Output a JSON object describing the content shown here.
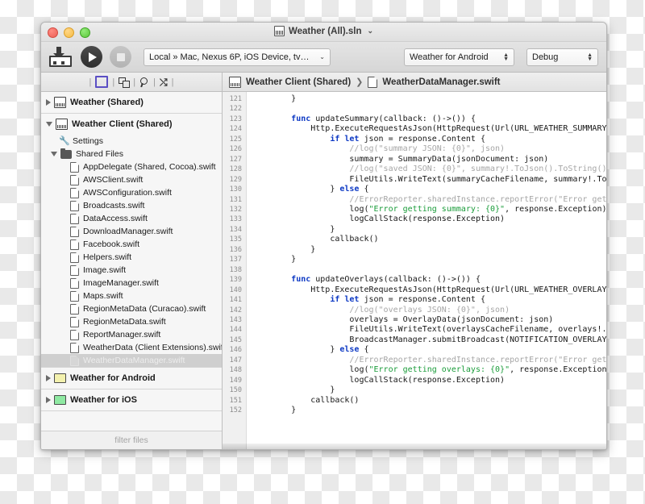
{
  "window": {
    "title": "Weather (All).sln",
    "title_chevron": "⌄",
    "app_icon": "save-to-tray-icon"
  },
  "toolbar": {
    "run_label": "Run",
    "stop_label": "Stop",
    "target": {
      "value": "Local » Mac, Nexus 6P, iOS Device, tv…",
      "chevron": "⌄"
    },
    "project": {
      "value": "Weather for Android",
      "stepper_up": "▲",
      "stepper_down": "▼"
    },
    "configuration": {
      "value": "Debug",
      "stepper_up": "▲",
      "stepper_down": "▼"
    }
  },
  "navbar": {
    "icons": [
      "square-outline-icon",
      "duplicate-icon",
      "search-icon",
      "shuffle-icon"
    ],
    "separator": "|",
    "shuffle_glyph": "⤭",
    "breadcrumb": {
      "project": "Weather Client (Shared)",
      "separator": "❯",
      "file": "WeatherDataManager.swift"
    }
  },
  "sidebar": {
    "groups": [
      {
        "header": {
          "label": "Weather (Shared)",
          "icon": "project-icon",
          "expanded": false,
          "twisty": "right"
        },
        "items": []
      },
      {
        "header": {
          "label": "Weather Client (Shared)",
          "icon": "project-icon",
          "expanded": true,
          "twisty": "down"
        },
        "items": [
          {
            "label": "Settings",
            "icon": "wrench-icon",
            "indent": 1,
            "twisty": "none",
            "selected": false
          },
          {
            "label": "Shared Files",
            "icon": "folder-icon",
            "indent": 1,
            "twisty": "down",
            "selected": false
          },
          {
            "label": "AppDelegate (Shared, Cocoa).swift",
            "icon": "file-icon",
            "indent": 2,
            "twisty": "none",
            "selected": false
          },
          {
            "label": "AWSClient.swift",
            "icon": "file-icon",
            "indent": 2,
            "twisty": "none",
            "selected": false
          },
          {
            "label": "AWSConfiguration.swift",
            "icon": "file-icon",
            "indent": 2,
            "twisty": "none",
            "selected": false
          },
          {
            "label": "Broadcasts.swift",
            "icon": "file-icon",
            "indent": 2,
            "twisty": "none",
            "selected": false
          },
          {
            "label": "DataAccess.swift",
            "icon": "file-icon",
            "indent": 2,
            "twisty": "none",
            "selected": false
          },
          {
            "label": "DownloadManager.swift",
            "icon": "file-icon",
            "indent": 2,
            "twisty": "none",
            "selected": false
          },
          {
            "label": "Facebook.swift",
            "icon": "file-icon",
            "indent": 2,
            "twisty": "none",
            "selected": false
          },
          {
            "label": "Helpers.swift",
            "icon": "file-icon",
            "indent": 2,
            "twisty": "none",
            "selected": false
          },
          {
            "label": "Image.swift",
            "icon": "file-icon",
            "indent": 2,
            "twisty": "none",
            "selected": false
          },
          {
            "label": "ImageManager.swift",
            "icon": "file-icon",
            "indent": 2,
            "twisty": "none",
            "selected": false
          },
          {
            "label": "Maps.swift",
            "icon": "file-icon",
            "indent": 2,
            "twisty": "none",
            "selected": false
          },
          {
            "label": "RegionMetaData (Curacao).swift",
            "icon": "file-icon",
            "indent": 2,
            "twisty": "none",
            "selected": false
          },
          {
            "label": "RegionMetaData.swift",
            "icon": "file-icon",
            "indent": 2,
            "twisty": "none",
            "selected": false
          },
          {
            "label": "ReportManager.swift",
            "icon": "file-icon",
            "indent": 2,
            "twisty": "none",
            "selected": false
          },
          {
            "label": "WeatherData (Client Extensions).swift",
            "icon": "file-icon",
            "indent": 2,
            "twisty": "none",
            "selected": false
          },
          {
            "label": "WeatherDataManager.swift",
            "icon": "file-icon",
            "indent": 2,
            "twisty": "none",
            "selected": true
          }
        ]
      },
      {
        "header": {
          "label": "Weather for Android",
          "icon": "cream-rect-icon",
          "expanded": false,
          "twisty": "right"
        },
        "items": []
      },
      {
        "header": {
          "label": "Weather for iOS",
          "icon": "green-rect-icon",
          "expanded": false,
          "twisty": "right"
        },
        "items": []
      }
    ],
    "filter_placeholder": "filter files"
  },
  "editor": {
    "first_line": 121,
    "lines": [
      {
        "n": 121,
        "tokens": [
          {
            "t": "        }",
            "c": ""
          }
        ]
      },
      {
        "n": 122,
        "tokens": [
          {
            "t": "",
            "c": ""
          }
        ]
      },
      {
        "n": 123,
        "tokens": [
          {
            "t": "        ",
            "c": ""
          },
          {
            "t": "func",
            "c": "k"
          },
          {
            "t": " updateSummary(callback: ()->()) {",
            "c": ""
          }
        ]
      },
      {
        "n": 124,
        "tokens": [
          {
            "t": "            Http.ExecuteRequestAsJson(HttpRequest(Url(URL_WEATHER_SUMMARY)))",
            "c": ""
          }
        ]
      },
      {
        "n": 125,
        "tokens": [
          {
            "t": "                ",
            "c": ""
          },
          {
            "t": "if let",
            "c": "k"
          },
          {
            "t": " json = response.Content {",
            "c": ""
          }
        ]
      },
      {
        "n": 126,
        "tokens": [
          {
            "t": "                    //log(\"summary JSON: {0}\", json)",
            "c": "c"
          }
        ]
      },
      {
        "n": 127,
        "tokens": [
          {
            "t": "                    summary = SummaryData(jsonDocument: json)",
            "c": ""
          }
        ]
      },
      {
        "n": 128,
        "tokens": [
          {
            "t": "                    //log(\"saved JSON: {0}\", summary!.ToJson().ToString())",
            "c": "c"
          }
        ]
      },
      {
        "n": 129,
        "tokens": [
          {
            "t": "                    FileUtils.WriteText(summaryCacheFilename, summary!.ToJson",
            "c": ""
          }
        ]
      },
      {
        "n": 130,
        "tokens": [
          {
            "t": "                } ",
            "c": ""
          },
          {
            "t": "else",
            "c": "k"
          },
          {
            "t": " {",
            "c": ""
          }
        ]
      },
      {
        "n": 131,
        "tokens": [
          {
            "t": "                    //ErrorReporter.sharedInstance.reportError(\"Error getting",
            "c": "c"
          }
        ]
      },
      {
        "n": 132,
        "tokens": [
          {
            "t": "                    log(",
            "c": ""
          },
          {
            "t": "\"Error getting summary: {0}\"",
            "c": "s"
          },
          {
            "t": ", response.Exception)",
            "c": ""
          }
        ]
      },
      {
        "n": 133,
        "tokens": [
          {
            "t": "                    logCallStack(response.Exception)",
            "c": ""
          }
        ]
      },
      {
        "n": 134,
        "tokens": [
          {
            "t": "                }",
            "c": ""
          }
        ]
      },
      {
        "n": 135,
        "tokens": [
          {
            "t": "                callback()",
            "c": ""
          }
        ]
      },
      {
        "n": 136,
        "tokens": [
          {
            "t": "            }",
            "c": ""
          }
        ]
      },
      {
        "n": 137,
        "tokens": [
          {
            "t": "        }",
            "c": ""
          }
        ]
      },
      {
        "n": 138,
        "tokens": [
          {
            "t": "",
            "c": ""
          }
        ]
      },
      {
        "n": 139,
        "tokens": [
          {
            "t": "        ",
            "c": ""
          },
          {
            "t": "func",
            "c": "k"
          },
          {
            "t": " updateOverlays(callback: ()->()) {",
            "c": ""
          }
        ]
      },
      {
        "n": 140,
        "tokens": [
          {
            "t": "            Http.ExecuteRequestAsJson(HttpRequest(Url(URL_WEATHER_OVERLAYS)))",
            "c": ""
          }
        ]
      },
      {
        "n": 141,
        "tokens": [
          {
            "t": "                ",
            "c": ""
          },
          {
            "t": "if let",
            "c": "k"
          },
          {
            "t": " json = response.Content {",
            "c": ""
          }
        ]
      },
      {
        "n": 142,
        "tokens": [
          {
            "t": "                    //log(\"overlays JSON: {0}\", json)",
            "c": "c"
          }
        ]
      },
      {
        "n": 143,
        "tokens": [
          {
            "t": "                    overlays = OverlayData(jsonDocument: json)",
            "c": ""
          }
        ]
      },
      {
        "n": 144,
        "tokens": [
          {
            "t": "                    FileUtils.WriteText(overlaysCacheFilename, overlays!.ToJs",
            "c": ""
          }
        ]
      },
      {
        "n": 145,
        "tokens": [
          {
            "t": "                    BroadcastManager.submitBroadcast(NOTIFICATION_OVERLAYS_UP",
            "c": ""
          }
        ]
      },
      {
        "n": 146,
        "tokens": [
          {
            "t": "                } ",
            "c": ""
          },
          {
            "t": "else",
            "c": "k"
          },
          {
            "t": " {",
            "c": ""
          }
        ]
      },
      {
        "n": 147,
        "tokens": [
          {
            "t": "                    //ErrorReporter.sharedInstance.reportError(\"Error getting",
            "c": "c"
          }
        ]
      },
      {
        "n": 148,
        "tokens": [
          {
            "t": "                    log(",
            "c": ""
          },
          {
            "t": "\"Error getting overlays: {0}\"",
            "c": "s"
          },
          {
            "t": ", response.Exception)",
            "c": ""
          }
        ]
      },
      {
        "n": 149,
        "tokens": [
          {
            "t": "                    logCallStack(response.Exception)",
            "c": ""
          }
        ]
      },
      {
        "n": 150,
        "tokens": [
          {
            "t": "                }",
            "c": ""
          }
        ]
      },
      {
        "n": 151,
        "tokens": [
          {
            "t": "            callback()",
            "c": ""
          }
        ]
      },
      {
        "n": 152,
        "tokens": [
          {
            "t": "        }",
            "c": ""
          }
        ]
      }
    ]
  },
  "colors": {
    "keyword": "#0d39c4",
    "comment": "#a6a6a6",
    "string": "#1a9c3a",
    "selection_bg": "#cfcfcf",
    "toolbar_accent": "#5b4fc4"
  }
}
